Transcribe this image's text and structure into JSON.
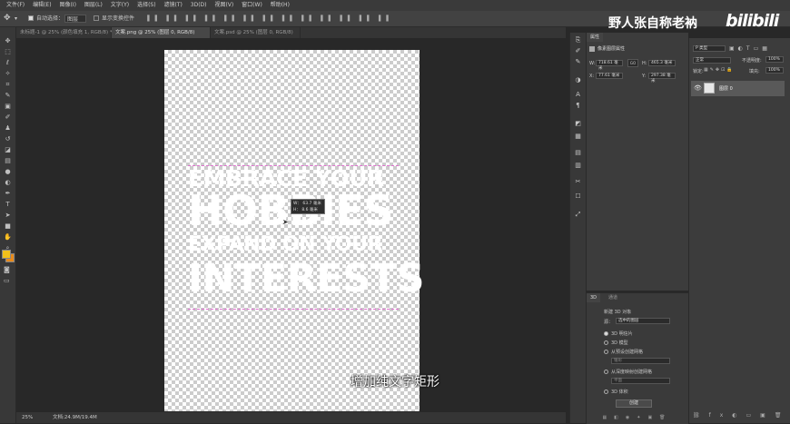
{
  "menubar": {
    "items": [
      "文件(F)",
      "编辑(E)",
      "图像(I)",
      "图层(L)",
      "文字(Y)",
      "选择(S)",
      "滤镜(T)",
      "3D(D)",
      "视图(V)",
      "窗口(W)",
      "帮助(H)"
    ]
  },
  "options": {
    "auto_select_label": "自动选择：",
    "auto_select_value": "图层",
    "show_transform_label": "显示变换控件"
  },
  "tabs": [
    {
      "label": "未标题-1 @ 25% (颜色填充 1, RGB/8) *",
      "active": false
    },
    {
      "label": "文案.png @ 25% (图层 0, RGB/8)",
      "active": true
    },
    {
      "label": "文案.psd @ 25% (图层 0, RGB/8)",
      "active": false
    }
  ],
  "poster": {
    "line1": "EMBRACE YOUR",
    "line2": "HOBBIES",
    "line3": "EXPAND ON YOUR",
    "line4": "INTERESTS"
  },
  "tooltip": {
    "line1": "W： 63.7 毫米",
    "line2": "H： 8.6 毫米"
  },
  "status": {
    "zoom": "25%",
    "doc": "文档:24.9M/19.4M"
  },
  "subtitle": "增加纯文字矩形",
  "watermark": {
    "text": "野人张自称老衲",
    "logo": "bilibili"
  },
  "properties": {
    "tab": "属性",
    "title": "像素图层属性",
    "w_label": "W:",
    "w_value": "718.61 毫米",
    "h_label": "H:",
    "h_value": "465.3 毫米",
    "x_label": "X:",
    "x_value": "77.61 毫米",
    "y_label": "Y:",
    "y_value": "297.38 毫米",
    "link_label": "GO"
  },
  "layers": {
    "kind_label": "类型",
    "blend_mode": "正常",
    "opacity_label": "不透明度:",
    "opacity_value": "100%",
    "lock_label": "锁定:",
    "fill_label": "填充:",
    "fill_value": "100%",
    "search_placeholder": "P 类型",
    "layer_name": "图层 0"
  },
  "panel3d": {
    "tab_3d": "3D",
    "tab_channels": "通道",
    "create_label": "新建 3D 对象",
    "source_label": "源：",
    "source_value": "选中的图层",
    "options": [
      "3D 明信片",
      "3D 模型",
      "从预设创建网格",
      "从深度映射创建网格",
      "3D 体积"
    ],
    "preset_sub": "锥形",
    "depth_sub": "平面",
    "create_button": "创建"
  },
  "colors": {
    "accent": "#f2c01b",
    "guide": "#e070d0"
  }
}
